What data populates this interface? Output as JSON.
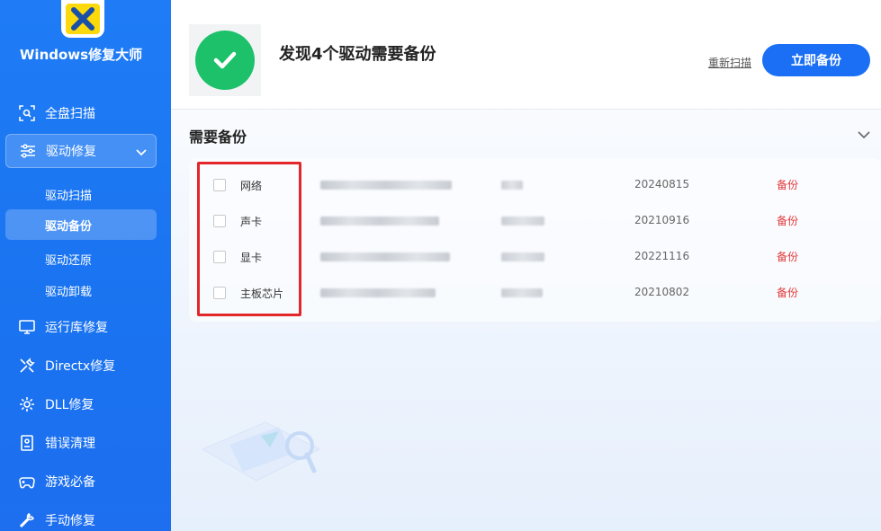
{
  "app": {
    "title": "Windows修复大师"
  },
  "sidebar": {
    "items": [
      {
        "label": "全盘扫描",
        "icon": "scan-icon"
      },
      {
        "label": "驱动修复",
        "icon": "sliders-icon",
        "expanded": true
      },
      {
        "label": "运行库修复",
        "icon": "monitor-icon"
      },
      {
        "label": "Directx修复",
        "icon": "tools-icon"
      },
      {
        "label": "DLL修复",
        "icon": "gear-icon"
      },
      {
        "label": "错误清理",
        "icon": "file-icon"
      },
      {
        "label": "游戏必备",
        "icon": "gamepad-icon"
      },
      {
        "label": "手动修复",
        "icon": "wrench-icon"
      }
    ],
    "subitems": [
      {
        "label": "驱动扫描"
      },
      {
        "label": "驱动备份",
        "active": true
      },
      {
        "label": "驱动还原"
      },
      {
        "label": "驱动卸载"
      }
    ]
  },
  "header": {
    "title": "发现4个驱动需要备份",
    "rescan_label": "重新扫描",
    "backup_button_label": "立即备份"
  },
  "section": {
    "title": "需要备份"
  },
  "drivers": [
    {
      "name": "网络",
      "date": "20240815",
      "action": "备份"
    },
    {
      "name": "声卡",
      "date": "20210916",
      "action": "备份"
    },
    {
      "name": "显卡",
      "date": "20221116",
      "action": "备份"
    },
    {
      "name": "主板芯片",
      "date": "20210802",
      "action": "备份"
    }
  ],
  "colors": {
    "accent": "#1a6ff5",
    "success": "#1cc16a",
    "danger": "#e23b3b",
    "highlight": "#e3262a"
  }
}
